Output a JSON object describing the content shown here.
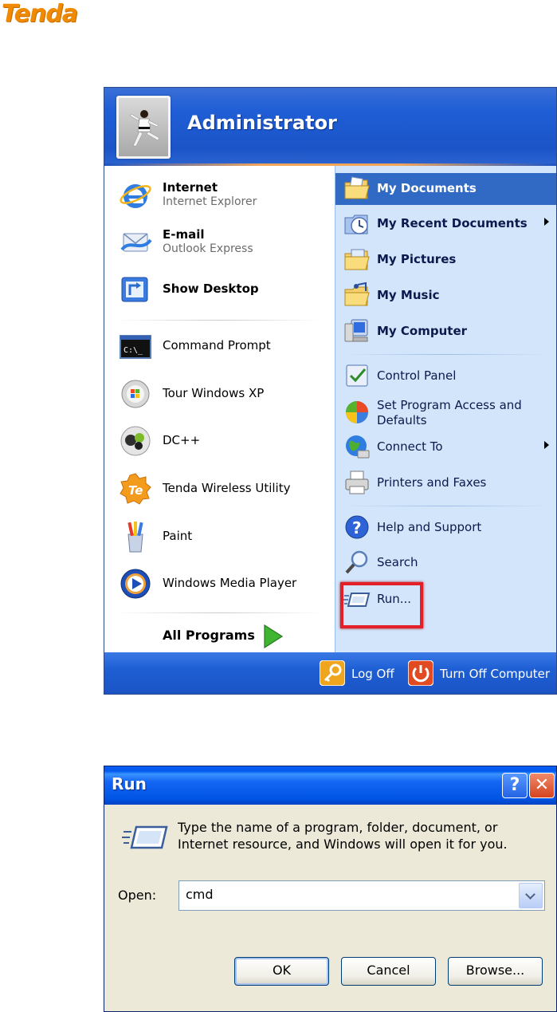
{
  "brand": {
    "logo_text": "Tenda"
  },
  "start_menu": {
    "username": "Administrator",
    "pinned": [
      {
        "title": "Internet",
        "subtitle": "Internet Explorer",
        "icon": "internet-explorer-icon"
      },
      {
        "title": "E-mail",
        "subtitle": "Outlook Express",
        "icon": "outlook-express-icon"
      },
      {
        "title": "Show Desktop",
        "icon": "show-desktop-icon"
      }
    ],
    "recent": [
      {
        "label": "Command Prompt",
        "icon": "command-prompt-icon"
      },
      {
        "label": "Tour Windows XP",
        "icon": "tour-windows-icon"
      },
      {
        "label": "DC++",
        "icon": "dcpp-icon"
      },
      {
        "label": "Tenda Wireless Utility",
        "icon": "tenda-utility-icon"
      },
      {
        "label": "Paint",
        "icon": "paint-icon"
      },
      {
        "label": "Windows Media Player",
        "icon": "media-player-icon"
      }
    ],
    "all_programs": "All Programs",
    "right_items": [
      {
        "label": "My Documents",
        "bold": true,
        "selected": true
      },
      {
        "label": "My Recent Documents",
        "bold": true,
        "submenu": true
      },
      {
        "label": "My Pictures",
        "bold": true
      },
      {
        "label": "My Music",
        "bold": true
      },
      {
        "label": "My Computer",
        "bold": true
      },
      {
        "label": "Control Panel"
      },
      {
        "label": "Set Program Access and Defaults"
      },
      {
        "label": "Connect To",
        "submenu": true
      },
      {
        "label": "Printers and Faxes"
      },
      {
        "label": "Help and Support"
      },
      {
        "label": "Search"
      },
      {
        "label": "Run..."
      }
    ],
    "footer": {
      "log_off": "Log Off",
      "turn_off": "Turn Off Computer"
    },
    "highlight_color": "#e3202a"
  },
  "run_dialog": {
    "title": "Run",
    "help_glyph": "?",
    "close_glyph": "✕",
    "description": "Type the name of a program, folder, document, or Internet resource, and Windows will open it for you.",
    "open_label": "Open:",
    "open_value": "cmd",
    "ok": "OK",
    "cancel": "Cancel",
    "browse": "Browse..."
  }
}
